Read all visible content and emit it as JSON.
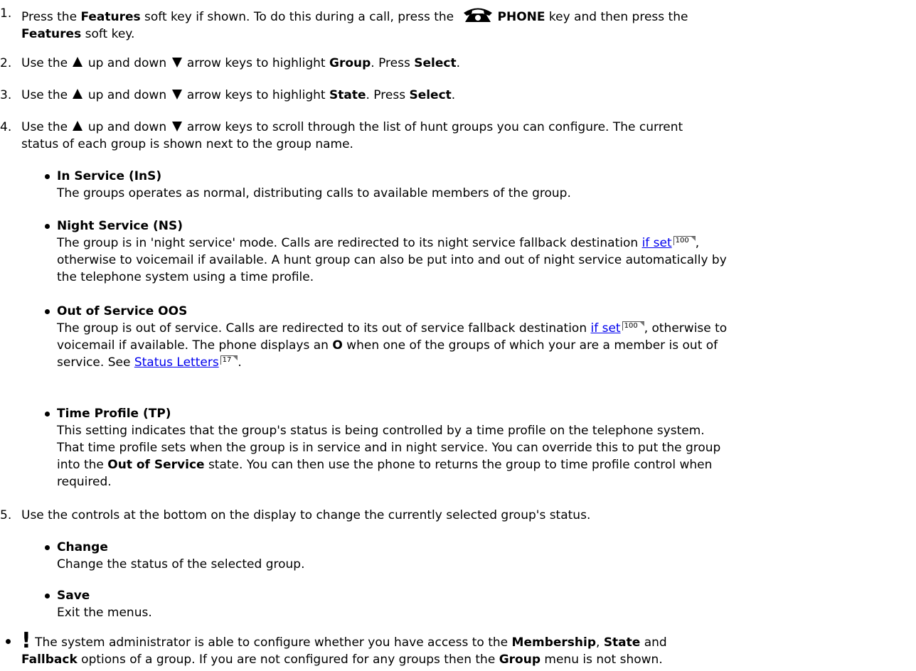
{
  "steps": [
    {
      "num": "1.",
      "pre": "Press the ",
      "b1": "Features",
      "mid": " soft key if shown. To do this during a call, press the ",
      "phone_icon": "phone-key-icon",
      "b2": "PHONE",
      "post": " key and then press the",
      "b3": "Features",
      "post2": " soft key."
    },
    {
      "num": "2.",
      "pre": "Use the ",
      "mid": " up and down ",
      "post": " arrow keys to highlight ",
      "b1": "Group",
      "post2": ". Press ",
      "b2": "Select",
      "end": "."
    },
    {
      "num": "3.",
      "pre": "Use the ",
      "mid": " up and down ",
      "post": " arrow keys to highlight ",
      "b1": "State",
      "post2": ". Press ",
      "b2": "Select",
      "end": "."
    },
    {
      "num": "4.",
      "pre": "Use the ",
      "mid": " up and down ",
      "post": " arrow keys to scroll through the list of hunt groups you can configure. The current",
      "line2": "status of each group is shown next to the group name."
    },
    {
      "num": "5.",
      "text": "Use the controls at the bottom on the display to change the currently selected group's status."
    }
  ],
  "states": [
    {
      "title": "In Service (InS)",
      "desc": "The groups operates as normal, distributing calls to available members of the group."
    },
    {
      "title": "Night Service (NS)",
      "desc_a": "The group is in 'night service' mode. Calls are redirected to its night service fallback destination ",
      "link": "if set",
      "ref": "100",
      "desc_b": ",",
      "desc_c": "otherwise to voicemail if available. A hunt group can also be put into and out of night service automatically by",
      "desc_d": "the telephone system using a time profile."
    },
    {
      "title": "Out of Service OOS",
      "desc_a": "The group is out of service. Calls are redirected to its out of service fallback destination ",
      "link": "if set",
      "ref": "100",
      "desc_b": ", otherwise to",
      "desc_c": "voicemail if available. The phone displays an ",
      "bold_o": "O",
      "desc_d": " when one of the groups of which your are a member is out of",
      "desc_e": "service. See ",
      "link2": "Status Letters",
      "ref2": "17",
      "desc_f": "."
    },
    {
      "title": "Time Profile (TP)",
      "l1": "This setting indicates that the group's status is being controlled by a time profile on the telephone system.",
      "l2": "That time profile sets when the group is in service and in night service. You can override this to put the group",
      "l3a": "into the ",
      "l3b": "Out of Service",
      "l3c": " state. You can then use the phone to returns the group to time profile control when",
      "l4": "required."
    }
  ],
  "controls": [
    {
      "title": "Change",
      "desc": "Change the status of the selected group."
    },
    {
      "title": "Save",
      "desc": "Exit the menus."
    }
  ],
  "note": {
    "mark": "!",
    "a": " The system administrator is able to configure whether you have access to the ",
    "b1": "Membership",
    "c": ", ",
    "b2": "State",
    "d": " and",
    "b3": "Fallback",
    "e": " options of a group. If you are not configured for any groups then the ",
    "b4": "Group",
    "f": " menu is not shown."
  }
}
